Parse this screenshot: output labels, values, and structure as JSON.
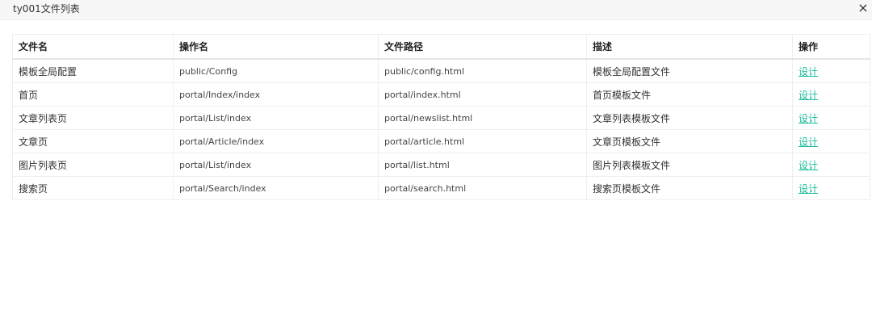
{
  "dialog": {
    "title": "ty001文件列表",
    "close_label": "×"
  },
  "table": {
    "headers": [
      "文件名",
      "操作名",
      "文件路径",
      "描述",
      "操作"
    ],
    "rows": [
      {
        "name": "模板全局配置",
        "action": "public/Config",
        "path": "public/config.html",
        "desc": "模板全局配置文件",
        "op": "设计"
      },
      {
        "name": "首页",
        "action": "portal/Index/index",
        "path": "portal/index.html",
        "desc": "首页模板文件",
        "op": "设计"
      },
      {
        "name": "文章列表页",
        "action": "portal/List/index",
        "path": "portal/newslist.html",
        "desc": "文章列表模板文件",
        "op": "设计"
      },
      {
        "name": "文章页",
        "action": "portal/Article/index",
        "path": "portal/article.html",
        "desc": "文章页模板文件",
        "op": "设计"
      },
      {
        "name": "图片列表页",
        "action": "portal/List/index",
        "path": "portal/list.html",
        "desc": "图片列表模板文件",
        "op": "设计"
      },
      {
        "name": "搜索页",
        "action": "portal/Search/index",
        "path": "portal/search.html",
        "desc": "搜索页模板文件",
        "op": "设计"
      }
    ]
  },
  "colors": {
    "link": "#1abc9c",
    "titlebar_bg": "#f7f7f7"
  }
}
